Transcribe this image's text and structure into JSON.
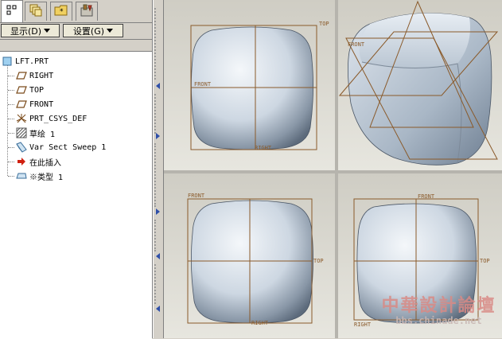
{
  "tabs": [
    {
      "icon": "model-tree-icon"
    },
    {
      "icon": "layers-icon"
    },
    {
      "icon": "favorites-icon"
    },
    {
      "icon": "tools-icon"
    }
  ],
  "toolbar": {
    "show_label": "显示(D)",
    "settings_label": "设置(G)"
  },
  "tree": {
    "root": "LFT.PRT",
    "items": [
      {
        "label": "RIGHT",
        "icon": "datum-plane-icon"
      },
      {
        "label": "TOP",
        "icon": "datum-plane-icon"
      },
      {
        "label": "FRONT",
        "icon": "datum-plane-icon"
      },
      {
        "label": "PRT_CSYS_DEF",
        "icon": "csys-icon"
      },
      {
        "label": "草绘 1",
        "icon": "sketch-icon"
      },
      {
        "label": "Var Sect Sweep 1",
        "icon": "sweep-icon"
      },
      {
        "label": "在此插入",
        "icon": "insert-here-arrow-icon"
      },
      {
        "label": "※类型 1",
        "icon": "feature-type-icon"
      }
    ]
  },
  "viewports": {
    "top_left": {
      "labels": {
        "top": "TOP",
        "front": "FRONT",
        "right": "RIGHT"
      }
    },
    "top_right": {
      "labels": {
        "front": "FRONT"
      }
    },
    "bottom_left": {
      "labels": {
        "front": "FRONT",
        "top": "TOP",
        "right": "RIGHT"
      }
    },
    "bottom_right": {
      "labels": {
        "front": "FRONT",
        "top": "TOP",
        "right": "RIGHT"
      }
    }
  },
  "watermark": {
    "title": "中華設計論壇",
    "url": "bbs.chinade.net"
  },
  "colors": {
    "datum": "#8a5a2a",
    "shape_light": "#eef2f6",
    "shape_dark": "#6e7f93",
    "viewport_bg": "#dcdad2"
  }
}
